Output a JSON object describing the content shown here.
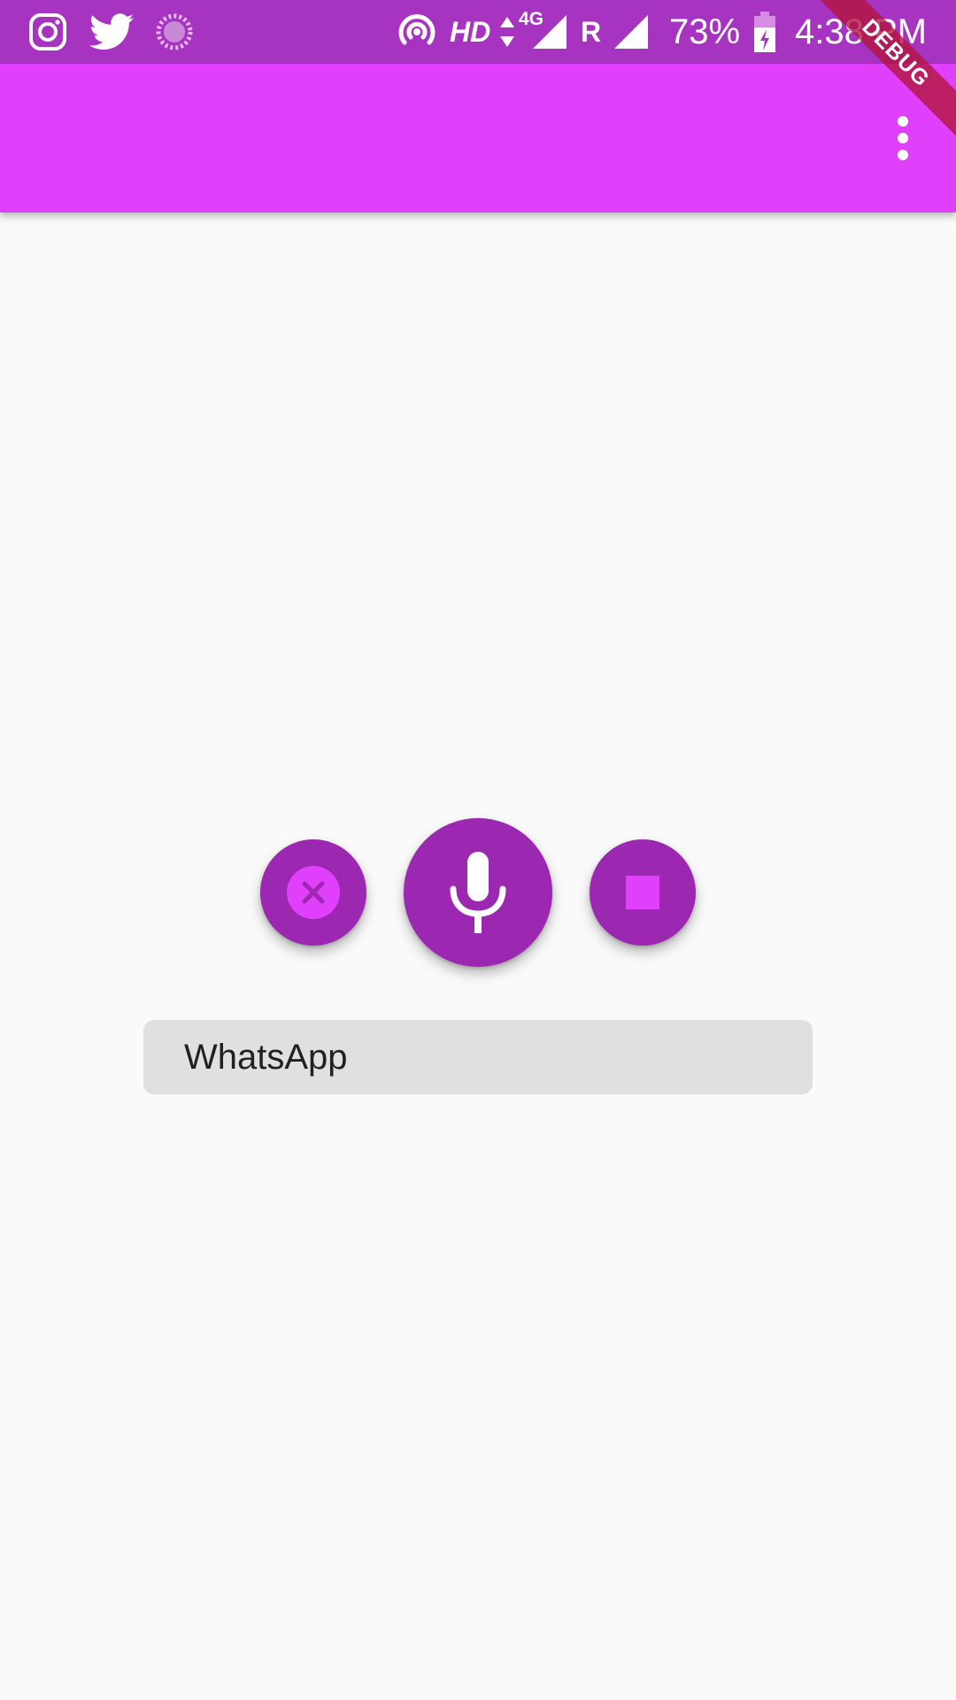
{
  "status_bar": {
    "notification_icons": [
      "instagram-icon",
      "twitter-icon",
      "loading-icon"
    ],
    "system_icons": [
      "hotspot-icon",
      "hd-icon",
      "data-arrows-icon",
      "signal-icon",
      "roaming-icon",
      "signal-icon",
      "battery-charging-icon"
    ],
    "hd_label": "HD",
    "network_label": "4G",
    "roaming_label": "R",
    "battery_percent": "73%",
    "time": "4:38 PM",
    "background_color": "#a734c0"
  },
  "app_bar": {
    "background_color": "#e040fb",
    "overflow_icon": "more-vert-icon"
  },
  "debug_banner": {
    "label": "DEBUG"
  },
  "controls": {
    "cancel_icon": "cancel-icon",
    "mic_icon": "microphone-icon",
    "stop_icon": "stop-icon",
    "fab_color": "#9c27b0",
    "accent_color": "#e040fb"
  },
  "recognized_text": {
    "value": "WhatsApp"
  }
}
